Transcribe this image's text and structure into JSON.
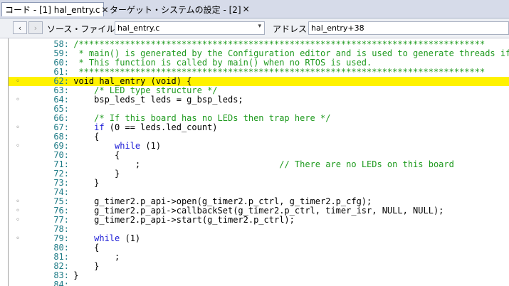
{
  "tabs": [
    {
      "label": "コード - [1] hal_entry.c",
      "close": "✕"
    },
    {
      "label": "ターゲット・システムの設定 - [2]",
      "close": "✕"
    }
  ],
  "toolbar": {
    "back_icon": "‹",
    "forward_icon": "›",
    "source_label": "ソース・ファイル",
    "file_value": "hal_entry.c",
    "combo_arrow": "▾",
    "address_label": "アドレス",
    "address_value": "hal_entry+38"
  },
  "code_lines": [
    {
      "num": "58:",
      "mark": "",
      "text": " /*******************************************************************************",
      "cls": "cmt",
      "hl": false
    },
    {
      "num": "59:",
      "mark": "",
      "text": "  * main() is generated by the Configuration editor and is used to generate threads if an",
      "cls": "cmt",
      "hl": false
    },
    {
      "num": "60:",
      "mark": "",
      "text": "  * This function is called by main() when no RTOS is used.",
      "cls": "cmt",
      "hl": false
    },
    {
      "num": "61:",
      "mark": "",
      "text": "  *******************************************************************************",
      "cls": "cmt",
      "hl": false
    },
    {
      "num": "62:",
      "mark": "◦",
      "text": " void hal_entry (void) {",
      "cls": "",
      "hl": true
    },
    {
      "num": "63:",
      "mark": "",
      "text": "     /* LED type structure */",
      "cls": "cmt",
      "hl": false
    },
    {
      "num": "64:",
      "mark": "◦",
      "text": "     bsp_leds_t leds = g_bsp_leds;",
      "cls": "",
      "hl": false
    },
    {
      "num": "65:",
      "mark": "",
      "text": "",
      "cls": "",
      "hl": false
    },
    {
      "num": "66:",
      "mark": "",
      "text": "     /* If this board has no LEDs then trap here */",
      "cls": "cmt",
      "hl": false
    },
    {
      "num": "67:",
      "mark": "◦",
      "text": "     if (0 == leds.led_count)",
      "cls": "",
      "hl": false
    },
    {
      "num": "68:",
      "mark": "",
      "text": "     {",
      "cls": "",
      "hl": false
    },
    {
      "num": "69:",
      "mark": "◦",
      "text": "         while (1)",
      "cls": "",
      "hl": false
    },
    {
      "num": "70:",
      "mark": "",
      "text": "         {",
      "cls": "",
      "hl": false
    },
    {
      "num": "71:",
      "mark": "",
      "text": "             ;                           // There are no LEDs on this board",
      "cls": "",
      "hl": false
    },
    {
      "num": "72:",
      "mark": "",
      "text": "         }",
      "cls": "",
      "hl": false
    },
    {
      "num": "73:",
      "mark": "",
      "text": "     }",
      "cls": "",
      "hl": false
    },
    {
      "num": "74:",
      "mark": "",
      "text": "",
      "cls": "",
      "hl": false
    },
    {
      "num": "75:",
      "mark": "◦",
      "text": "     g_timer2.p_api->open(g_timer2.p_ctrl, g_timer2.p_cfg);",
      "cls": "",
      "hl": false
    },
    {
      "num": "76:",
      "mark": "◦",
      "text": "     g_timer2.p_api->callbackSet(g_timer2.p_ctrl, timer_isr, NULL, NULL);",
      "cls": "",
      "hl": false
    },
    {
      "num": "77:",
      "mark": "◦",
      "text": "     g_timer2.p_api->start(g_timer2.p_ctrl);",
      "cls": "",
      "hl": false
    },
    {
      "num": "78:",
      "mark": "",
      "text": "",
      "cls": "",
      "hl": false
    },
    {
      "num": "79:",
      "mark": "◦",
      "text": "     while (1)",
      "cls": "",
      "hl": false
    },
    {
      "num": "80:",
      "mark": "",
      "text": "     {",
      "cls": "",
      "hl": false
    },
    {
      "num": "81:",
      "mark": "",
      "text": "         ;",
      "cls": "",
      "hl": false
    },
    {
      "num": "82:",
      "mark": "",
      "text": "     }",
      "cls": "",
      "hl": false
    },
    {
      "num": "83:",
      "mark": "",
      "text": " }",
      "cls": "",
      "hl": false
    },
    {
      "num": "84:",
      "mark": "",
      "text": "",
      "cls": "",
      "hl": false
    }
  ],
  "colors": {
    "highlight": "#fff200",
    "comment": "#1e9a1e",
    "keyword": "#1b1bd6",
    "line_number": "#1e7b86"
  }
}
